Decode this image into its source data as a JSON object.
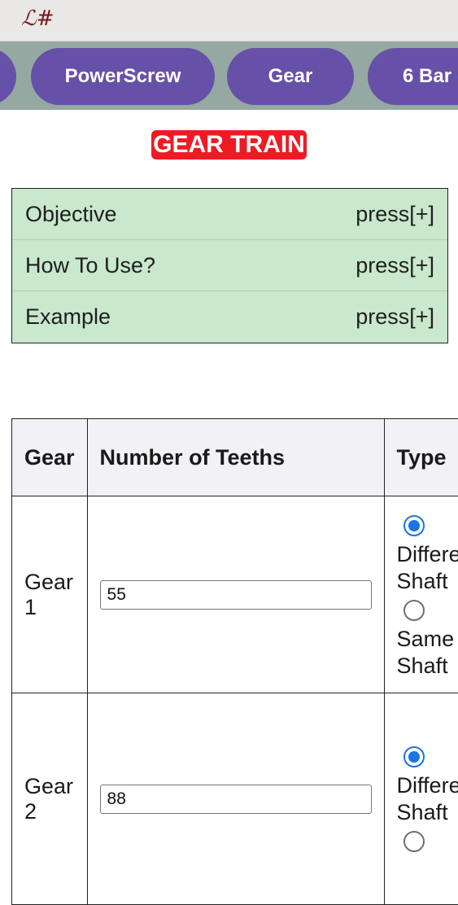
{
  "app": {
    "logo": "ℒ#"
  },
  "nav": {
    "tabs": [
      {
        "label": ""
      },
      {
        "label": "PowerScrew"
      },
      {
        "label": "Gear"
      },
      {
        "label": "6 Bar ("
      }
    ]
  },
  "page": {
    "title": "GEAR TRAIN"
  },
  "accordion": {
    "items": [
      {
        "label": "Objective",
        "action": "press[+]"
      },
      {
        "label": "How To Use?",
        "action": "press[+]"
      },
      {
        "label": "Example",
        "action": "press[+]"
      }
    ]
  },
  "table": {
    "headers": [
      "Gear",
      "Number of Teeths",
      "Type"
    ],
    "rows": [
      {
        "gear_line1": "Gear",
        "gear_line2": "1",
        "teeth": "55",
        "option1_l1": "Differe",
        "option1_l2": "Shaft",
        "option2_l1": "Same",
        "option2_l2": "Shaft",
        "selected": "option1"
      },
      {
        "gear_line1": "Gear",
        "gear_line2": "2",
        "teeth": "88",
        "option1_l1": "Differe",
        "option1_l2": "Shaft",
        "selected": "option1"
      }
    ]
  },
  "colors": {
    "accent": "#6650a8",
    "nav_bg": "#96a8a2",
    "title_bg": "#ee1b24",
    "accordion_bg": "#c9e8cd",
    "radio_selected": "#1a73e8"
  }
}
